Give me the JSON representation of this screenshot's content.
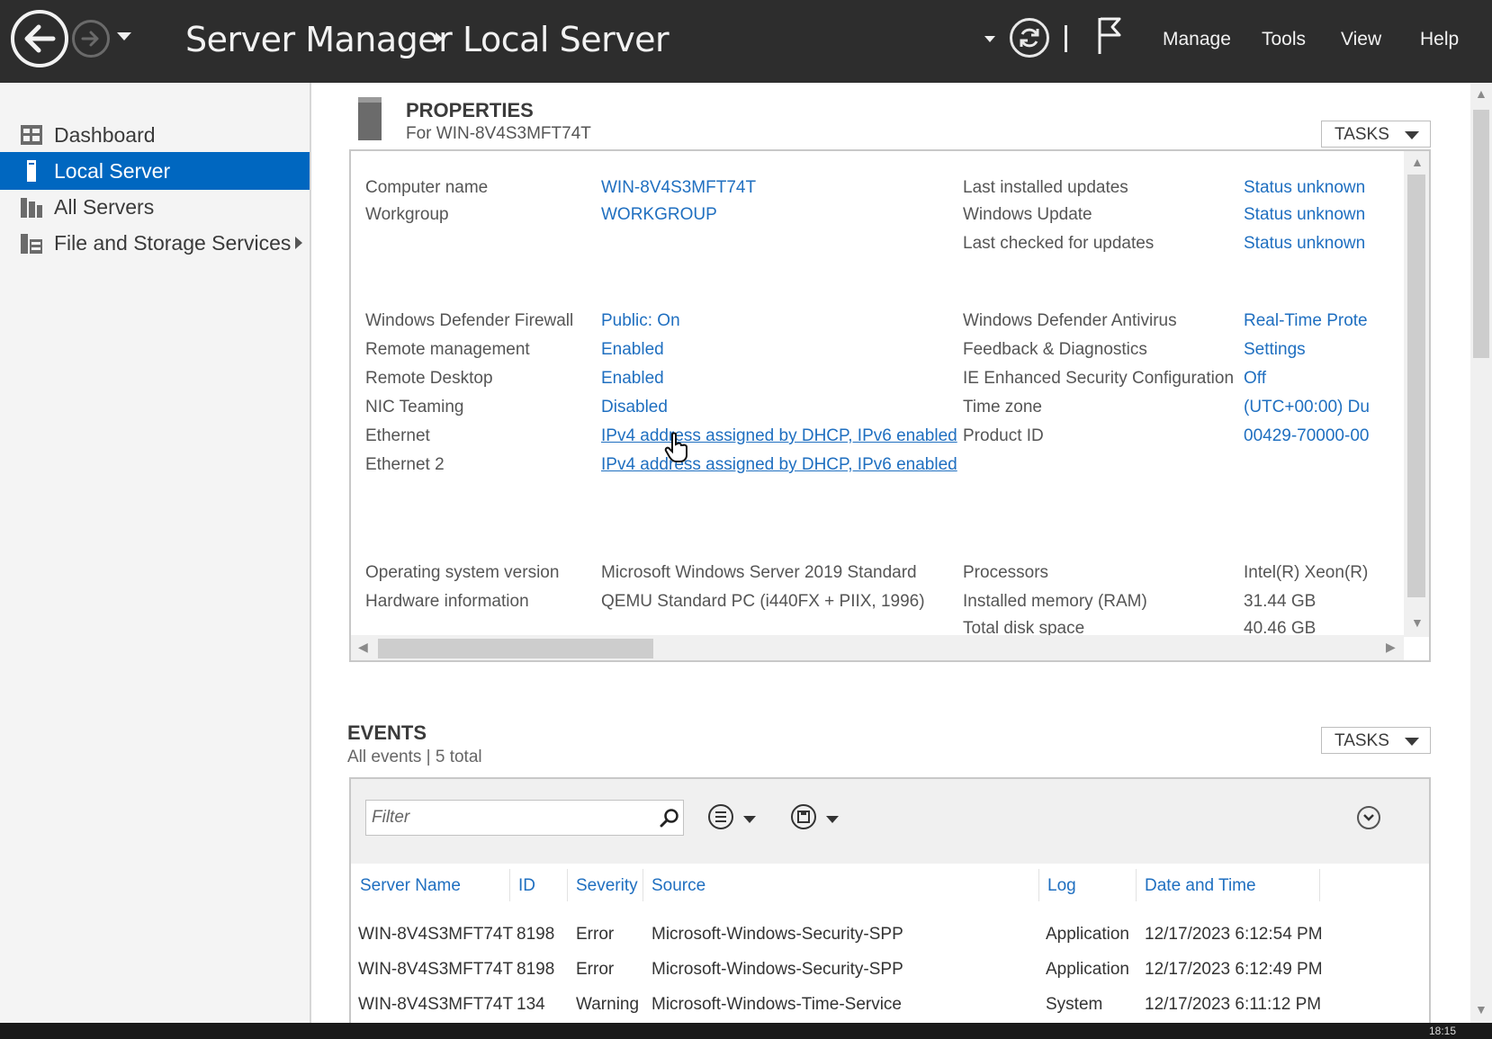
{
  "titlebar": {
    "app_title": "Server Manager",
    "page_title": "Local Server",
    "menu": [
      "Manage",
      "Tools",
      "View",
      "Help"
    ]
  },
  "sidebar": {
    "items": [
      {
        "label": "Dashboard",
        "icon": "dashboard-icon",
        "active": false
      },
      {
        "label": "Local Server",
        "icon": "server-icon",
        "active": true
      },
      {
        "label": "All Servers",
        "icon": "servers-icon",
        "active": false
      },
      {
        "label": "File and Storage Services",
        "icon": "storage-icon",
        "active": false
      }
    ]
  },
  "properties": {
    "title": "PROPERTIES",
    "subtitle": "For WIN-8V4S3MFT74T",
    "tasks_label": "TASKS",
    "rows_left": [
      {
        "label": "Computer name",
        "value": "WIN-8V4S3MFT74T"
      },
      {
        "label": "Workgroup",
        "value": "WORKGROUP"
      },
      {
        "label": "Windows Defender Firewall",
        "value": "Public: On"
      },
      {
        "label": "Remote management",
        "value": "Enabled"
      },
      {
        "label": "Remote Desktop",
        "value": "Enabled"
      },
      {
        "label": "NIC Teaming",
        "value": "Disabled"
      },
      {
        "label": "Ethernet",
        "value": "IPv4 address assigned by DHCP, IPv6 enabled"
      },
      {
        "label": "Ethernet 2",
        "value": "IPv4 address assigned by DHCP, IPv6 enabled"
      },
      {
        "label": "Operating system version",
        "value": "Microsoft Windows Server 2019 Standard"
      },
      {
        "label": "Hardware information",
        "value": "QEMU Standard PC (i440FX + PIIX, 1996)"
      }
    ],
    "rows_right": [
      {
        "label": "Last installed updates",
        "value": "Status unknown"
      },
      {
        "label": "Windows Update",
        "value": "Status unknown"
      },
      {
        "label": "Last checked for updates",
        "value": "Status unknown"
      },
      {
        "label": "Windows Defender Antivirus",
        "value": "Real-Time Prote"
      },
      {
        "label": "Feedback & Diagnostics",
        "value": "Settings"
      },
      {
        "label": "IE Enhanced Security Configuration",
        "value": "Off"
      },
      {
        "label": "Time zone",
        "value": "(UTC+00:00) Du"
      },
      {
        "label": "Product ID",
        "value": "00429-70000-00"
      },
      {
        "label": "Processors",
        "value": "Intel(R) Xeon(R)"
      },
      {
        "label": "Installed memory (RAM)",
        "value": "31.44 GB"
      },
      {
        "label": "Total disk space",
        "value": "40.46 GB"
      }
    ]
  },
  "events": {
    "title": "EVENTS",
    "subtitle": "All events | 5 total",
    "tasks_label": "TASKS",
    "filter_placeholder": "Filter",
    "columns": [
      "Server Name",
      "ID",
      "Severity",
      "Source",
      "Log",
      "Date and Time"
    ],
    "rows": [
      [
        "WIN-8V4S3MFT74T",
        "8198",
        "Error",
        "Microsoft-Windows-Security-SPP",
        "Application",
        "12/17/2023 6:12:54 PM"
      ],
      [
        "WIN-8V4S3MFT74T",
        "8198",
        "Error",
        "Microsoft-Windows-Security-SPP",
        "Application",
        "12/17/2023 6:12:49 PM"
      ],
      [
        "WIN-8V4S3MFT74T",
        "134",
        "Warning",
        "Microsoft-Windows-Time-Service",
        "System",
        "12/17/2023 6:11:12 PM"
      ]
    ]
  },
  "taskbar": {
    "time": "18:15"
  },
  "colors": {
    "accent": "#0067c0",
    "link": "#1f6fc0",
    "titlebar": "#2d2d2d"
  }
}
